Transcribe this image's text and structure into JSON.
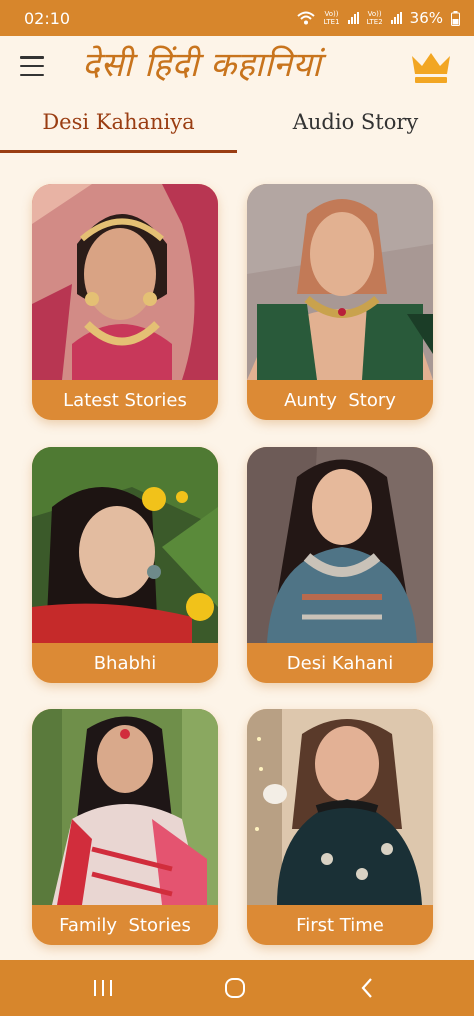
{
  "status_bar": {
    "time": "02:10",
    "sim1_label_top": "Vo))",
    "sim1_label_bottom": "LTE1",
    "sim2_label_top": "Vo))",
    "sim2_label_bottom": "LTE2",
    "battery": "36%"
  },
  "app_bar": {
    "title": "देसी हिंदी कहानियां",
    "menu_icon": "hamburger-menu-icon",
    "premium_icon": "crown-icon"
  },
  "tabs": [
    {
      "label": "Desi Kahaniya",
      "selected": true
    },
    {
      "label": "Audio Story",
      "selected": false
    }
  ],
  "categories": [
    {
      "label": "Latest Stories"
    },
    {
      "label": "Aunty  Story"
    },
    {
      "label": "Bhabhi"
    },
    {
      "label": "Desi Kahani"
    },
    {
      "label": "Family  Stories"
    },
    {
      "label": "First Time"
    }
  ],
  "nav_bar": {
    "recents_icon": "recents-icon",
    "home_icon": "home-icon",
    "back_icon": "back-icon"
  },
  "colors": {
    "primary": "#d7862c",
    "background": "#fdf4e8",
    "title": "#c8741d",
    "tab_selected": "#9a3d12"
  }
}
